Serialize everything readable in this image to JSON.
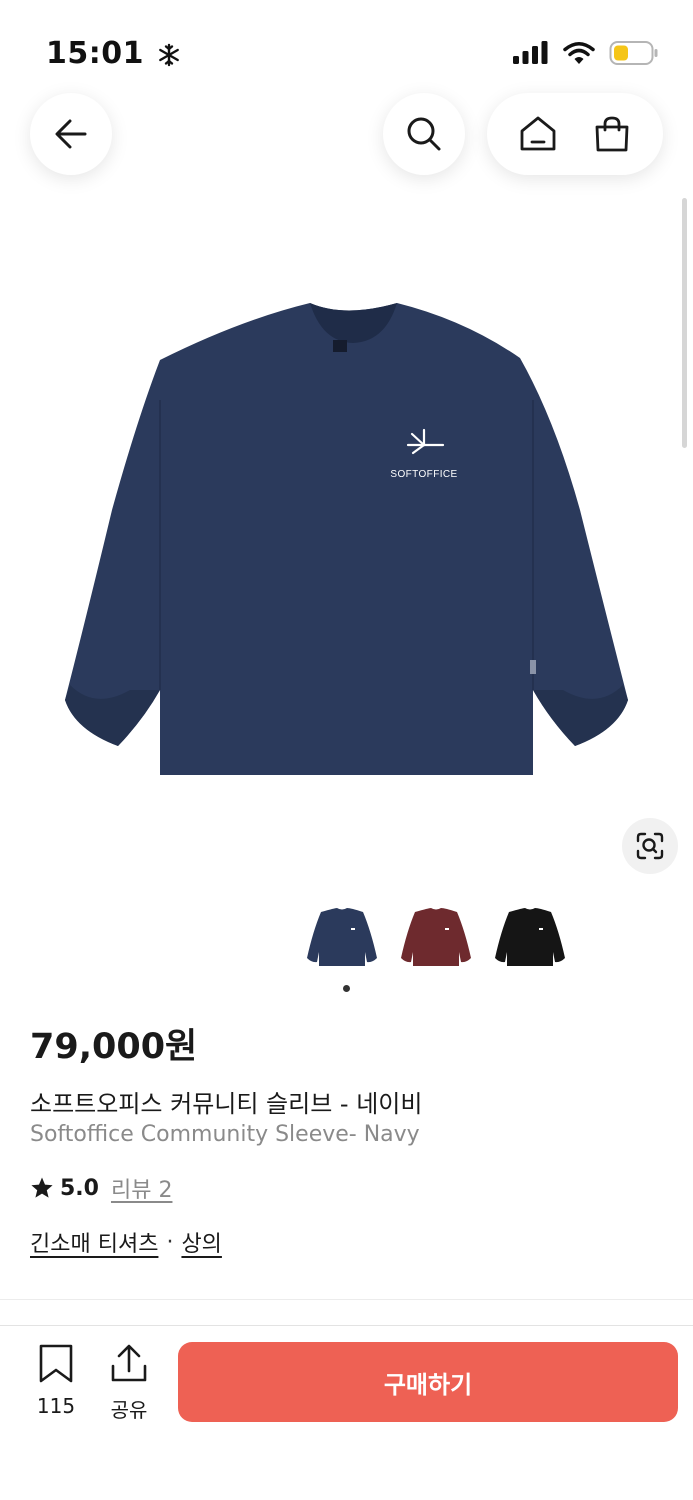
{
  "status_bar": {
    "time": "15:01",
    "weather_icon": "snowflake-icon"
  },
  "nav": {
    "back_icon": "arrow-left-icon",
    "search_icon": "search-icon",
    "home_icon": "home-icon",
    "cart_icon": "shopping-bag-icon"
  },
  "product": {
    "price": "79,000원",
    "title_ko": "소프트오피스 커뮤니티 슬리브 - 네이비",
    "title_en": "Softoffice Community Sleeve- Navy",
    "rating": "5.0",
    "review_label": "리뷰 2",
    "categories": [
      "긴소매 티셔츠",
      "상의"
    ],
    "category_separator": "·",
    "image_brand_text": "SOFTOFFICE",
    "thumbnails": [
      {
        "color": "#2b3a5c",
        "name": "Navy"
      },
      {
        "color": "#6e2a2e",
        "name": "Burgundy"
      },
      {
        "color": "#151515",
        "name": "Black"
      }
    ]
  },
  "bottom_bar": {
    "bookmark_count": "115",
    "share_label": "공유",
    "buy_label": "구매하기"
  },
  "colors": {
    "accent": "#ee6154",
    "shirt_navy": "#2b3a5c"
  }
}
